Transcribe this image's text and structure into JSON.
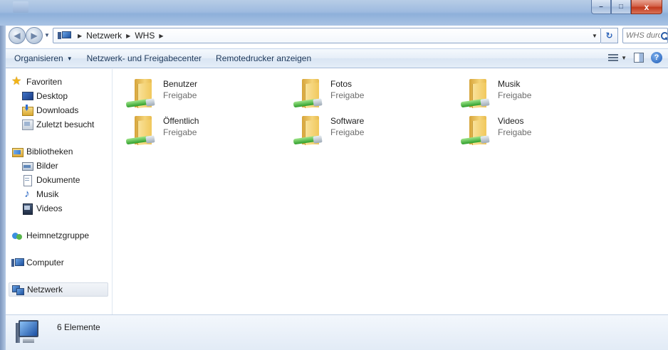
{
  "window": {
    "buttons": {
      "minimize": "–",
      "maximize": "□",
      "close": "x"
    }
  },
  "address_bar": {
    "crumbs": [
      "Netzwerk",
      "WHS"
    ],
    "search_placeholder": "WHS durch..."
  },
  "command_bar": {
    "organize_label": "Organisieren",
    "network_center_label": "Netzwerk- und Freigabecenter",
    "remote_printers_label": "Remotedrucker anzeigen",
    "help_label": "?"
  },
  "nav_pane": {
    "favorites": {
      "label": "Favoriten",
      "items": [
        "Desktop",
        "Downloads",
        "Zuletzt besucht"
      ]
    },
    "libraries": {
      "label": "Bibliotheken",
      "items": [
        "Bilder",
        "Dokumente",
        "Musik",
        "Videos"
      ]
    },
    "homegroup_label": "Heimnetzgruppe",
    "computer_label": "Computer",
    "network_label": "Netzwerk"
  },
  "shares": [
    {
      "name": "Benutzer",
      "type": "Freigabe"
    },
    {
      "name": "Fotos",
      "type": "Freigabe"
    },
    {
      "name": "Musik",
      "type": "Freigabe"
    },
    {
      "name": "Öffentlich",
      "type": "Freigabe"
    },
    {
      "name": "Software",
      "type": "Freigabe"
    },
    {
      "name": "Videos",
      "type": "Freigabe"
    }
  ],
  "details": {
    "item_count": "6 Elemente"
  }
}
